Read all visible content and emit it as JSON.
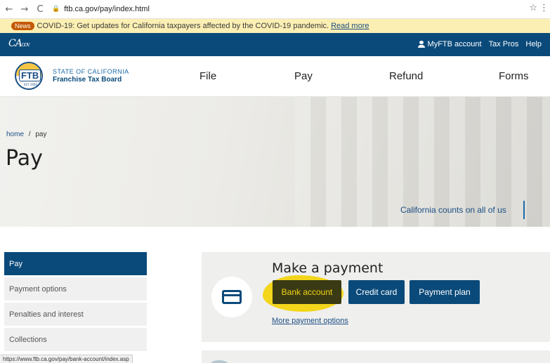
{
  "browser": {
    "back": "←",
    "forward": "→",
    "reload": "C",
    "url": "ftb.ca.gov/pay/index.html",
    "star": "☆",
    "menu": "⋮"
  },
  "news": {
    "badge": "News",
    "text": "COVID-19: Get updates for California taxpayers affected by the COVID-19 pandemic.",
    "link": "Read more"
  },
  "util": {
    "ca_logo": "CA",
    "ca_sub": "GOV",
    "myftb": "MyFTB account",
    "tax_pros": "Tax Pros",
    "help": "Help"
  },
  "header": {
    "logo_text": "FTB",
    "logo_sub": "EST 1950",
    "agency_line1": "STATE OF CALIFORNIA",
    "agency_line2": "Franchise Tax Board",
    "nav": [
      "File",
      "Pay",
      "Refund",
      "Forms"
    ]
  },
  "hero": {
    "crumb_home": "home",
    "crumb_sep": "/",
    "crumb_current": "pay",
    "title": "Pay",
    "tagline": "California counts on all of us"
  },
  "sidebar": {
    "items": [
      {
        "label": "Pay",
        "active": true
      },
      {
        "label": "Payment options"
      },
      {
        "label": "Penalties and interest"
      },
      {
        "label": "Collections"
      }
    ]
  },
  "status_url": "https://www.ftb.ca.gov/pay/bank-account/index.asp",
  "payment": {
    "heading": "Make a payment",
    "buttons": [
      "Bank account",
      "Credit card",
      "Payment plan"
    ],
    "more_link": "More payment options"
  },
  "colors": {
    "primary": "#0a4a7a",
    "link": "#1b4e84",
    "news_bg": "#fcefb3",
    "highlight": "#f2d410"
  }
}
